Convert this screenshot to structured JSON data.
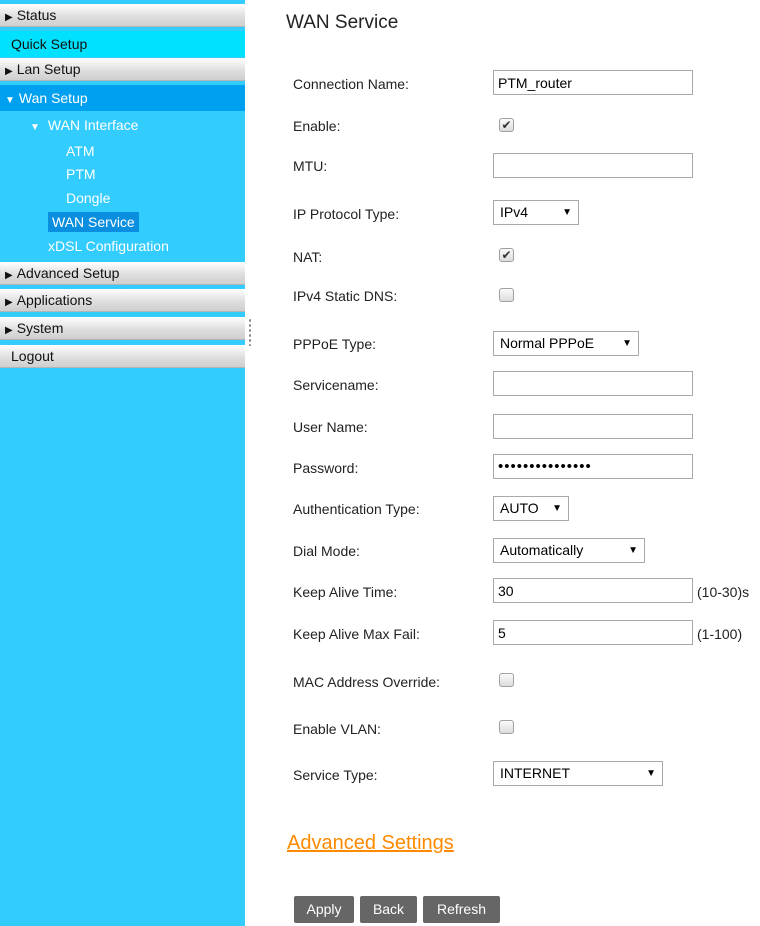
{
  "sidebar": {
    "status": "Status",
    "quick_setup": "Quick Setup",
    "lan_setup": "Lan Setup",
    "wan_setup": "Wan Setup",
    "wan_interface": "WAN Interface",
    "atm": "ATM",
    "ptm": "PTM",
    "dongle": "Dongle",
    "wan_service": "WAN Service",
    "xdsl": "xDSL Configuration",
    "advanced_setup": "Advanced Setup",
    "applications": "Applications",
    "system": "System",
    "logout": "Logout"
  },
  "page": {
    "title": "WAN Service"
  },
  "form": {
    "connection_name": {
      "label": "Connection Name:",
      "value": "PTM_router"
    },
    "enable": {
      "label": "Enable:",
      "checked": true
    },
    "mtu": {
      "label": "MTU:",
      "value": ""
    },
    "ip_protocol": {
      "label": "IP Protocol Type:",
      "value": "IPv4"
    },
    "nat": {
      "label": "NAT:",
      "checked": true
    },
    "ipv4_static_dns": {
      "label": "IPv4 Static DNS:",
      "checked": false
    },
    "pppoe_type": {
      "label": "PPPoE Type:",
      "value": "Normal PPPoE"
    },
    "servicename": {
      "label": "Servicename:",
      "value": ""
    },
    "user_name": {
      "label": "User Name:",
      "value": ""
    },
    "password": {
      "label": "Password:",
      "value": "•••••••••••••••"
    },
    "auth_type": {
      "label": "Authentication Type:",
      "value": "AUTO"
    },
    "dial_mode": {
      "label": "Dial Mode:",
      "value": "Automatically"
    },
    "keep_alive_time": {
      "label": "Keep Alive Time:",
      "value": "30",
      "hint": "(10-30)s"
    },
    "keep_alive_max_fail": {
      "label": "Keep Alive Max Fail:",
      "value": "5",
      "hint": "(1-100)"
    },
    "mac_override": {
      "label": "MAC Address Override:",
      "checked": false
    },
    "enable_vlan": {
      "label": "Enable VLAN:",
      "checked": false
    },
    "service_type": {
      "label": "Service Type:",
      "value": "INTERNET"
    }
  },
  "advanced_link": "Advanced Settings",
  "buttons": {
    "apply": "Apply",
    "back": "Back",
    "refresh": "Refresh"
  },
  "icons": {
    "collapsed": "triangle-right-icon",
    "expanded": "triangle-down-icon",
    "checkmark": "checkmark-icon",
    "dropdown": "dropdown-arrow-icon"
  },
  "colors": {
    "sidebar_bg": "#33ccff",
    "quick_setup_bg": "#00e1ff",
    "active_bg": "#00a0f0",
    "selected_bg": "#0a8fe0",
    "link": "#ff8a00",
    "button_bg": "#666666"
  }
}
